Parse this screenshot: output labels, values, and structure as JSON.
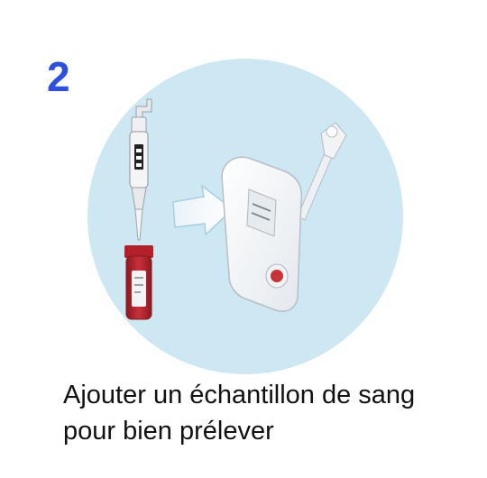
{
  "step": {
    "number": "2"
  },
  "caption": {
    "line1": "Ajouter un échantillon de sang",
    "line2": "pour bien prélever"
  },
  "colors": {
    "step_number": "#2c4fe0",
    "circle_background": "#cde7f3",
    "blood": "#b3202a",
    "test_cassette": "#f7f9fb"
  },
  "icons": [
    "pipette-icon",
    "blood-sample-tube-icon",
    "arrow-right-icon",
    "test-cassette-icon"
  ]
}
